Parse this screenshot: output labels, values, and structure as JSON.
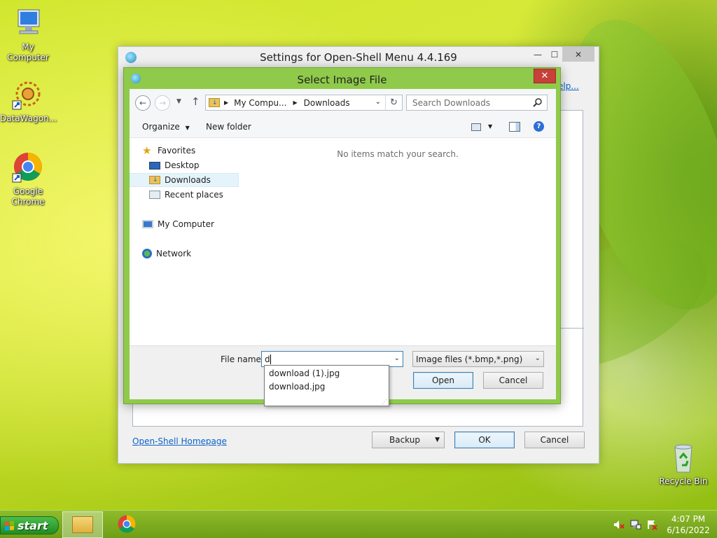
{
  "desktop": {
    "icons": [
      {
        "label": "My Computer"
      },
      {
        "label": "DataWagon..."
      },
      {
        "label": "Google Chrome"
      },
      {
        "label": "Recycle Bin"
      }
    ]
  },
  "settings_window": {
    "title": "Settings for Open-Shell Menu 4.4.169",
    "help_link": "elp...",
    "homepage_link": "Open-Shell Homepage",
    "backup_label": "Backup",
    "ok_label": "OK",
    "cancel_label": "Cancel"
  },
  "dialog": {
    "title": "Select Image File",
    "close_label": "✕",
    "address": {
      "segments": [
        "My Compu...",
        "Downloads"
      ]
    },
    "search": {
      "placeholder": "Search Downloads"
    },
    "commands": {
      "organize": "Organize",
      "new_folder": "New folder"
    },
    "nav": {
      "favorites": "Favorites",
      "desktop": "Desktop",
      "downloads": "Downloads",
      "recent": "Recent places",
      "computer": "My Computer",
      "network": "Network"
    },
    "empty_message": "No items match your search.",
    "file_name_label": "File name:",
    "file_name_value": "d",
    "file_type": "Image files (*.bmp,*.png)",
    "open_label": "Open",
    "cancel_label": "Cancel",
    "suggestions": [
      "download (1).jpg",
      "download.jpg"
    ]
  },
  "taskbar": {
    "start_label": "start",
    "clock": {
      "time": "4:07 PM",
      "date": "6/16/2022"
    }
  },
  "colors": {
    "dialog_frame": "#8fca4a",
    "close_button": "#c7403a",
    "taskbar": "#7aa81c",
    "start_button": "#2e9f2e"
  }
}
